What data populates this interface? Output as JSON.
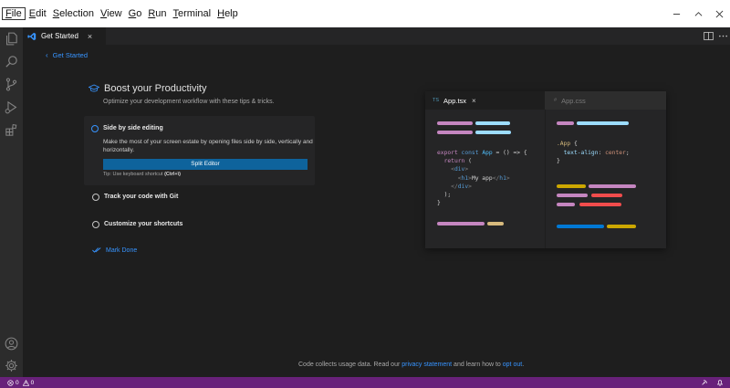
{
  "menubar": {
    "items": [
      {
        "label": "File",
        "underline": "F",
        "rest": "ile"
      },
      {
        "label": "Edit",
        "underline": "E",
        "rest": "dit"
      },
      {
        "label": "Selection",
        "underline": "S",
        "rest": "election"
      },
      {
        "label": "View",
        "underline": "V",
        "rest": "iew"
      },
      {
        "label": "Go",
        "underline": "G",
        "rest": "o"
      },
      {
        "label": "Run",
        "underline": "R",
        "rest": "un"
      },
      {
        "label": "Terminal",
        "underline": "T",
        "rest": "erminal"
      },
      {
        "label": "Help",
        "underline": "H",
        "rest": "elp"
      }
    ]
  },
  "activity_bar": {
    "icons": [
      "explorer-icon",
      "search-icon",
      "source-control-icon",
      "run-debug-icon",
      "extensions-icon",
      "accounts-icon",
      "manage-gear-icon"
    ]
  },
  "tab": {
    "label": "Get Started",
    "close": "×"
  },
  "walkthrough": {
    "back_label": "Get Started",
    "title": "Boost your Productivity",
    "subtitle": "Optimize your development workflow with these tips & tricks.",
    "steps": [
      {
        "title": "Side by side editing",
        "description": "Make the most of your screen estate by opening files side by side, vertically and horizontally.",
        "button": "Split Editor",
        "tip_prefix": "Tip: Use keyboard shortcut ",
        "tip_shortcut": "(Ctrl+\\)"
      },
      {
        "title": "Track your code with Git"
      },
      {
        "title": "Customize your shortcuts"
      }
    ],
    "mark_done": "Mark Done"
  },
  "preview": {
    "tabs": [
      {
        "badge": "TS",
        "label": "App.tsx",
        "close": "×"
      },
      {
        "badge": "#",
        "label": "App.css"
      }
    ],
    "tsx_code": [
      "export const App = () => {",
      "  return (",
      "    <div>",
      "      <h1>My app</h1>",
      "    </div>",
      "  );",
      "}"
    ],
    "css_code": [
      ".App {",
      "  text-align: center;",
      "}"
    ]
  },
  "footer": {
    "prefix": "Code collects usage data. Read our ",
    "privacy_link": "privacy statement",
    "middle": " and learn how to ",
    "optout_link": "opt out",
    "suffix": "."
  },
  "status_bar": {
    "errors": "0",
    "warnings": "0"
  },
  "colors": {
    "accent": "#3794ff",
    "status_bar": "#68217a",
    "button": "#0e639c",
    "purple_bar": "#c586c0",
    "cyan_bar": "#9cdcfe",
    "yellow_bar": "#d7ba7d",
    "red_bar": "#f14c4c",
    "blue_bar": "#0078d4",
    "gold_bar": "#cca700"
  }
}
